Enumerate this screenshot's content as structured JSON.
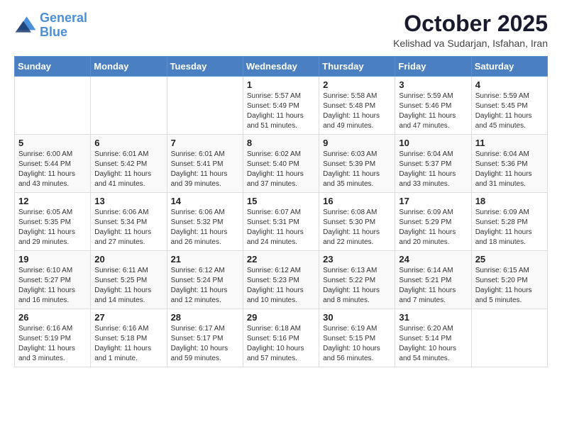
{
  "logo": {
    "line1": "General",
    "line2": "Blue"
  },
  "header": {
    "title": "October 2025",
    "subtitle": "Kelishad va Sudarjan, Isfahan, Iran"
  },
  "days_of_week": [
    "Sunday",
    "Monday",
    "Tuesday",
    "Wednesday",
    "Thursday",
    "Friday",
    "Saturday"
  ],
  "weeks": [
    [
      {
        "day": "",
        "info": ""
      },
      {
        "day": "",
        "info": ""
      },
      {
        "day": "",
        "info": ""
      },
      {
        "day": "1",
        "info": "Sunrise: 5:57 AM\nSunset: 5:49 PM\nDaylight: 11 hours\nand 51 minutes."
      },
      {
        "day": "2",
        "info": "Sunrise: 5:58 AM\nSunset: 5:48 PM\nDaylight: 11 hours\nand 49 minutes."
      },
      {
        "day": "3",
        "info": "Sunrise: 5:59 AM\nSunset: 5:46 PM\nDaylight: 11 hours\nand 47 minutes."
      },
      {
        "day": "4",
        "info": "Sunrise: 5:59 AM\nSunset: 5:45 PM\nDaylight: 11 hours\nand 45 minutes."
      }
    ],
    [
      {
        "day": "5",
        "info": "Sunrise: 6:00 AM\nSunset: 5:44 PM\nDaylight: 11 hours\nand 43 minutes."
      },
      {
        "day": "6",
        "info": "Sunrise: 6:01 AM\nSunset: 5:42 PM\nDaylight: 11 hours\nand 41 minutes."
      },
      {
        "day": "7",
        "info": "Sunrise: 6:01 AM\nSunset: 5:41 PM\nDaylight: 11 hours\nand 39 minutes."
      },
      {
        "day": "8",
        "info": "Sunrise: 6:02 AM\nSunset: 5:40 PM\nDaylight: 11 hours\nand 37 minutes."
      },
      {
        "day": "9",
        "info": "Sunrise: 6:03 AM\nSunset: 5:39 PM\nDaylight: 11 hours\nand 35 minutes."
      },
      {
        "day": "10",
        "info": "Sunrise: 6:04 AM\nSunset: 5:37 PM\nDaylight: 11 hours\nand 33 minutes."
      },
      {
        "day": "11",
        "info": "Sunrise: 6:04 AM\nSunset: 5:36 PM\nDaylight: 11 hours\nand 31 minutes."
      }
    ],
    [
      {
        "day": "12",
        "info": "Sunrise: 6:05 AM\nSunset: 5:35 PM\nDaylight: 11 hours\nand 29 minutes."
      },
      {
        "day": "13",
        "info": "Sunrise: 6:06 AM\nSunset: 5:34 PM\nDaylight: 11 hours\nand 27 minutes."
      },
      {
        "day": "14",
        "info": "Sunrise: 6:06 AM\nSunset: 5:32 PM\nDaylight: 11 hours\nand 26 minutes."
      },
      {
        "day": "15",
        "info": "Sunrise: 6:07 AM\nSunset: 5:31 PM\nDaylight: 11 hours\nand 24 minutes."
      },
      {
        "day": "16",
        "info": "Sunrise: 6:08 AM\nSunset: 5:30 PM\nDaylight: 11 hours\nand 22 minutes."
      },
      {
        "day": "17",
        "info": "Sunrise: 6:09 AM\nSunset: 5:29 PM\nDaylight: 11 hours\nand 20 minutes."
      },
      {
        "day": "18",
        "info": "Sunrise: 6:09 AM\nSunset: 5:28 PM\nDaylight: 11 hours\nand 18 minutes."
      }
    ],
    [
      {
        "day": "19",
        "info": "Sunrise: 6:10 AM\nSunset: 5:27 PM\nDaylight: 11 hours\nand 16 minutes."
      },
      {
        "day": "20",
        "info": "Sunrise: 6:11 AM\nSunset: 5:25 PM\nDaylight: 11 hours\nand 14 minutes."
      },
      {
        "day": "21",
        "info": "Sunrise: 6:12 AM\nSunset: 5:24 PM\nDaylight: 11 hours\nand 12 minutes."
      },
      {
        "day": "22",
        "info": "Sunrise: 6:12 AM\nSunset: 5:23 PM\nDaylight: 11 hours\nand 10 minutes."
      },
      {
        "day": "23",
        "info": "Sunrise: 6:13 AM\nSunset: 5:22 PM\nDaylight: 11 hours\nand 8 minutes."
      },
      {
        "day": "24",
        "info": "Sunrise: 6:14 AM\nSunset: 5:21 PM\nDaylight: 11 hours\nand 7 minutes."
      },
      {
        "day": "25",
        "info": "Sunrise: 6:15 AM\nSunset: 5:20 PM\nDaylight: 11 hours\nand 5 minutes."
      }
    ],
    [
      {
        "day": "26",
        "info": "Sunrise: 6:16 AM\nSunset: 5:19 PM\nDaylight: 11 hours\nand 3 minutes."
      },
      {
        "day": "27",
        "info": "Sunrise: 6:16 AM\nSunset: 5:18 PM\nDaylight: 11 hours\nand 1 minute."
      },
      {
        "day": "28",
        "info": "Sunrise: 6:17 AM\nSunset: 5:17 PM\nDaylight: 10 hours\nand 59 minutes."
      },
      {
        "day": "29",
        "info": "Sunrise: 6:18 AM\nSunset: 5:16 PM\nDaylight: 10 hours\nand 57 minutes."
      },
      {
        "day": "30",
        "info": "Sunrise: 6:19 AM\nSunset: 5:15 PM\nDaylight: 10 hours\nand 56 minutes."
      },
      {
        "day": "31",
        "info": "Sunrise: 6:20 AM\nSunset: 5:14 PM\nDaylight: 10 hours\nand 54 minutes."
      },
      {
        "day": "",
        "info": ""
      }
    ]
  ]
}
